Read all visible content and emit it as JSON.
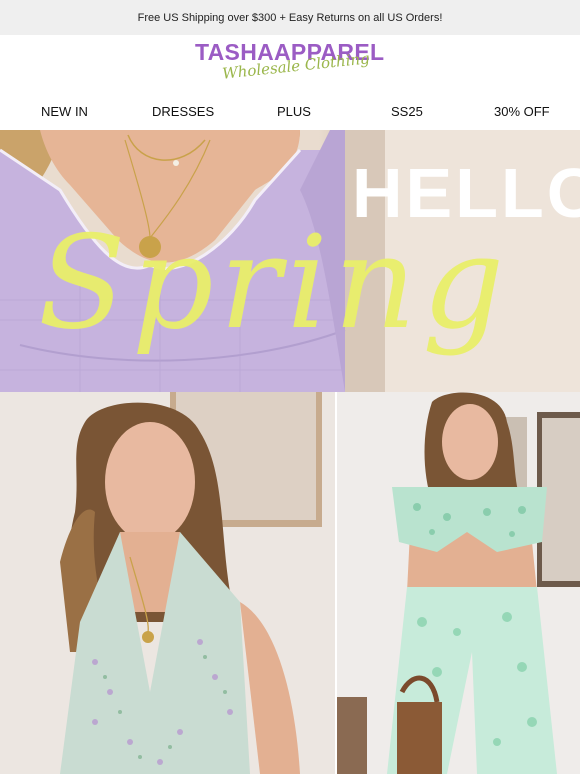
{
  "promo_bar": {
    "text": "Free US Shipping over $300 + Easy Returns on all US Orders!"
  },
  "brand": {
    "name": "TASHAAPPAREL",
    "tagline": "Wholesale Clothing",
    "primary_color": "#9b5cc4",
    "accent_color": "#9ab64a"
  },
  "nav": {
    "items": [
      {
        "label": "NEW IN"
      },
      {
        "label": "DRESSES"
      },
      {
        "label": "PLUS"
      },
      {
        "label": "SS25"
      },
      {
        "label": "30% OFF"
      }
    ]
  },
  "hero": {
    "headline": "HELLO",
    "script": "Spring",
    "script_color": "#e9ef6a"
  },
  "images": {
    "hero_image": "model in lilac gingham puff-sleeve top",
    "left_image": "model in green floral sleeveless dress",
    "right_image": "model in mint print crop top and trousers"
  }
}
